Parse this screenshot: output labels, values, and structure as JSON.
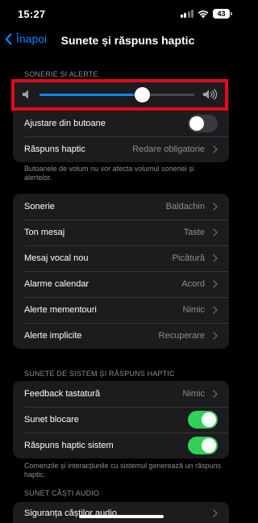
{
  "status_bar": {
    "time": "15:27",
    "battery": "43"
  },
  "nav": {
    "back_label": "Înapoi",
    "title": "Sunete și răspuns haptic"
  },
  "ringer_section": {
    "header": "SONERIE ȘI ALERTE",
    "volume_level": 0.66,
    "rows": [
      {
        "label": "Ajustare din butoane",
        "toggle": false
      },
      {
        "label": "Răspuns haptic",
        "value": "Redare obligatorie"
      }
    ],
    "footnote": "Butoanele de volum nu vor afecta volumul soneriei și alertelor."
  },
  "tones_section": {
    "rows": [
      {
        "label": "Sonerie",
        "value": "Baldachin"
      },
      {
        "label": "Ton mesaj",
        "value": "Taste"
      },
      {
        "label": "Mesaj vocal nou",
        "value": "Picătură"
      },
      {
        "label": "Alarme calendar",
        "value": "Acord"
      },
      {
        "label": "Alerte mementouri",
        "value": "Nimic"
      },
      {
        "label": "Alerte implicite",
        "value": "Recuperare"
      }
    ]
  },
  "system_section": {
    "header": "SUNETE DE SISTEM ȘI RĂSPUNS HAPTIC",
    "rows": [
      {
        "label": "Feedback tastatură",
        "value": "Nimic"
      },
      {
        "label": "Sunet blocare",
        "toggle": true
      },
      {
        "label": "Răspuns haptic sistem",
        "toggle": true
      }
    ],
    "footnote": "Comenzile și interacțiunile cu sistemul generează un răspuns haptic."
  },
  "audio_section": {
    "header": "SUNET CĂȘTI AUDIO",
    "rows": [
      {
        "label": "Siguranța căștilor audio"
      }
    ]
  },
  "colors": {
    "accent": "#0a84ff",
    "toggle_on": "#30d158",
    "highlight": "#e3081a"
  }
}
